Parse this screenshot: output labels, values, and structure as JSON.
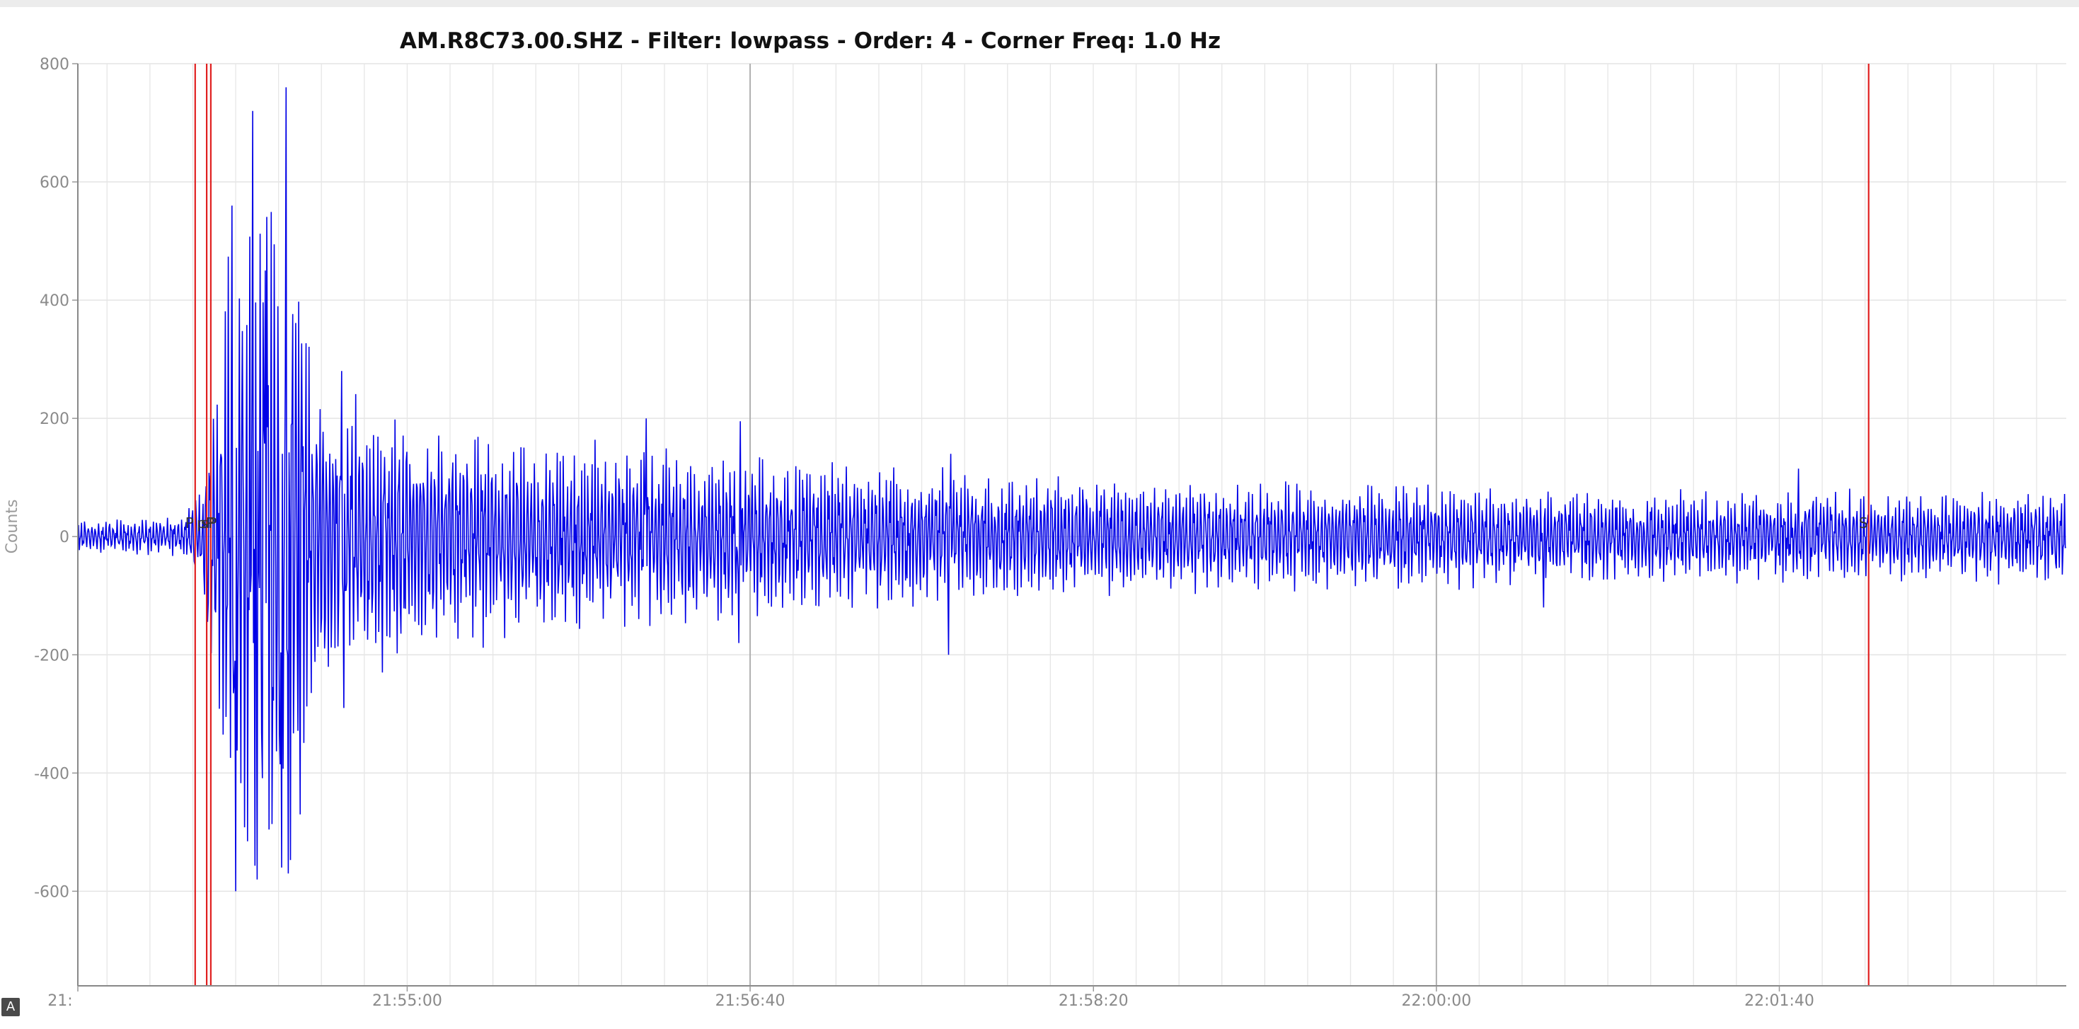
{
  "chart_data": {
    "type": "line",
    "title": "AM.R8C73.00.SHZ - Filter: lowpass - Order: 4 - Corner Freq: 1.0 Hz",
    "ylabel": "Counts",
    "xlabel": "",
    "ylim": [
      -760,
      800
    ],
    "yticks": [
      800,
      600,
      400,
      200,
      0,
      -200,
      -400,
      -600
    ],
    "x_start_seconds": 0,
    "x_end_seconds": 483,
    "x_tick_labels": [
      {
        "sec": 0,
        "label": "21:"
      },
      {
        "sec": 80,
        "label": "21:55:00"
      },
      {
        "sec": 163.3,
        "label": "21:56:40"
      },
      {
        "sec": 246.7,
        "label": "21:58:20"
      },
      {
        "sec": 330,
        "label": "22:00:00"
      },
      {
        "sec": 413.3,
        "label": "22:01:40"
      }
    ],
    "major_grid_seconds": [
      163.3,
      330
    ],
    "grid": true,
    "series": [
      {
        "color": "#0000e6",
        "envelope": [
          {
            "t": 0,
            "amp": 30
          },
          {
            "t": 26,
            "amp": 35
          },
          {
            "t": 30,
            "amp": 120
          },
          {
            "t": 38,
            "amp": 560
          },
          {
            "t": 46,
            "amp": 720
          },
          {
            "t": 51,
            "amp": 740
          },
          {
            "t": 57,
            "amp": 300
          },
          {
            "t": 75,
            "amp": 220
          },
          {
            "t": 110,
            "amp": 170
          },
          {
            "t": 160,
            "amp": 150
          },
          {
            "t": 210,
            "amp": 120
          },
          {
            "t": 260,
            "amp": 100
          },
          {
            "t": 330,
            "amp": 90
          },
          {
            "t": 400,
            "amp": 80
          },
          {
            "t": 483,
            "amp": 80
          }
        ],
        "spikes": [
          {
            "t": 37.5,
            "v": 560
          },
          {
            "t": 38.3,
            "v": -600
          },
          {
            "t": 42.5,
            "v": 720
          },
          {
            "t": 43.5,
            "v": -580
          },
          {
            "t": 45.5,
            "v": 450
          },
          {
            "t": 49.5,
            "v": -560
          },
          {
            "t": 50.5,
            "v": 760
          },
          {
            "t": 51.2,
            "v": -570
          },
          {
            "t": 54,
            "v": -470
          },
          {
            "t": 64,
            "v": 280
          },
          {
            "t": 64.6,
            "v": -290
          },
          {
            "t": 74,
            "v": -230
          },
          {
            "t": 138,
            "v": 200
          },
          {
            "t": 161,
            "v": 195
          },
          {
            "t": 160.5,
            "v": -180
          },
          {
            "t": 212,
            "v": 140
          },
          {
            "t": 211.5,
            "v": -200
          },
          {
            "t": 356,
            "v": -120
          },
          {
            "t": 418,
            "v": 115
          }
        ]
      }
    ],
    "phase_lines": [
      {
        "sec": 28.5,
        "label": "P"
      },
      {
        "sec": 31.3,
        "label": "pP"
      },
      {
        "sec": 32.3,
        "label": "sP"
      },
      {
        "sec": 435,
        "label": "S"
      }
    ],
    "phase_color": "#e02020"
  },
  "badge": {
    "text": "A"
  }
}
